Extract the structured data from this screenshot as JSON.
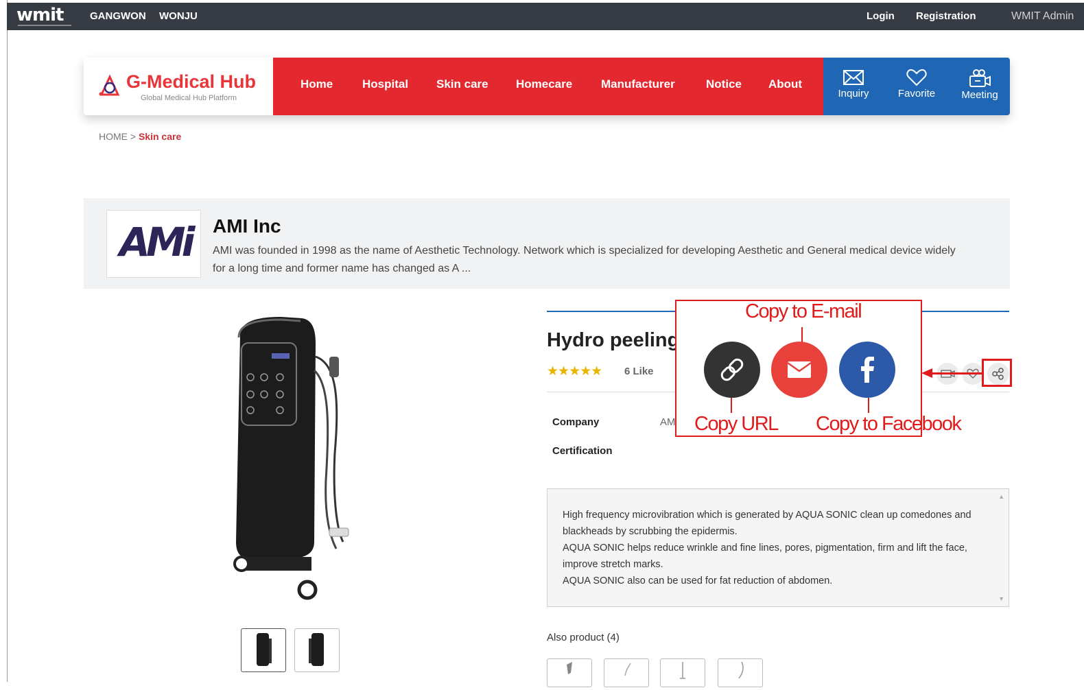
{
  "topbar": {
    "logo": "wmit",
    "regions": [
      "GANGWON",
      "WONJU"
    ],
    "login": "Login",
    "registration": "Registration",
    "admin": "WMIT Admin"
  },
  "header": {
    "brand_name": "G-Medical Hub",
    "brand_tagline": "Global Medical Hub Platform",
    "nav": [
      "Home",
      "Hospital",
      "Skin care",
      "Homecare",
      "Manufacturer",
      "Notice",
      "About"
    ],
    "actions": [
      {
        "label": "Inquiry",
        "icon": "envelope-icon"
      },
      {
        "label": "Favorite",
        "icon": "heart-icon"
      },
      {
        "label": "Meeting",
        "icon": "video-meeting-icon"
      }
    ],
    "nav_color": "#e3292f",
    "actions_color": "#1f67b4"
  },
  "breadcrumb": {
    "home": "HOME",
    "separator": ">",
    "current": "Skin care"
  },
  "company": {
    "logo_text": "AMi",
    "name": "AMI Inc",
    "description": "AMI was founded in 1998 as the name of Aesthetic Technology. Network which is specialized for developing Aesthetic and General medical device widely for a long time and former name has changed as A ..."
  },
  "product": {
    "title": "Hydro peeling",
    "stars": "★★★★★",
    "likes": "6 Like",
    "company_label": "Company",
    "company_value": "AM",
    "certification_label": "Certification",
    "description": [
      "High frequency microvibration which is generated by AQUA SONIC clean up comedones and blackheads by scrubbing the epidermis.",
      "AQUA SONIC helps reduce wrinkle and fine lines, pores, pigmentation, firm and lift the face, improve stretch marks.",
      "AQUA SONIC also can be used for fat reduction of abdomen."
    ],
    "also_product": "Also product (4)"
  },
  "share_popup": {
    "copy_email": "Copy to E-mail",
    "copy_url": "Copy URL",
    "copy_facebook": "Copy to Facebook",
    "url_color": "#333333",
    "email_color": "#e8413c",
    "facebook_color": "#2d5aa8",
    "annotation_color": "#e01b1b"
  }
}
